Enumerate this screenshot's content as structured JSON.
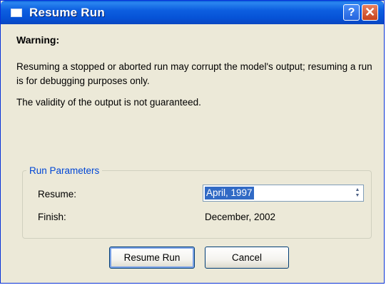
{
  "window": {
    "title": "Resume Run",
    "help_glyph": "?",
    "close_glyph": "✕",
    "icon": "window-icon"
  },
  "content": {
    "warning_title": "Warning:",
    "paragraph1": "Resuming a stopped or aborted run may corrupt the model's output; resuming a run is for debugging purposes only.",
    "paragraph2": "The validity of the output is not guaranteed."
  },
  "run_parameters": {
    "legend": "Run Parameters",
    "resume_label": "Resume:",
    "resume_value": "April, 1997",
    "finish_label": "Finish:",
    "finish_value": "December, 2002"
  },
  "buttons": {
    "resume_run": "Resume Run",
    "cancel": "Cancel"
  },
  "colors": {
    "title_bar": "#0a5fd8",
    "dialog_bg": "#ece9d8",
    "selection": "#316ac5",
    "group_legend": "#0046d5"
  }
}
